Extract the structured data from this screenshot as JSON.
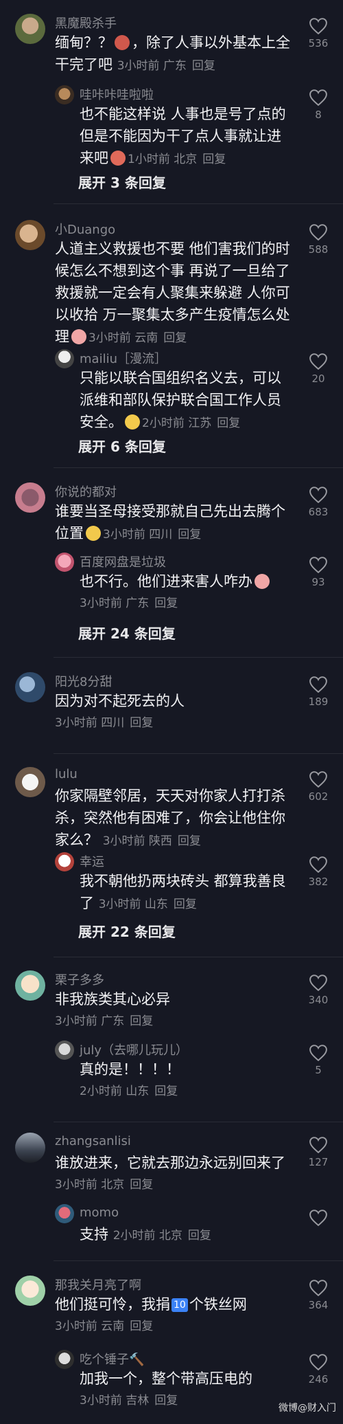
{
  "comments": [
    {
      "user": "黑魔殿杀手",
      "l1": "缅甸？？",
      "l1b": "，除了人事以外基本上全",
      "l2": "干完了吧",
      "time": "3小时前",
      "loc": "广东",
      "reply": "回复",
      "likes": "536",
      "sub": {
        "user": "哇咔咔哇啦啦",
        "l1": "也不能这样说 人事也是号了点的",
        "l2": "但是不能因为干了点人事就让进",
        "l3": "来吧",
        "time": "1小时前",
        "loc": "北京",
        "reply": "回复",
        "likes": "8"
      },
      "expand": "展开 3 条回复"
    },
    {
      "user": "小Duango",
      "l1": "人道主义救援也不要 他们害我们的时",
      "l2": "候怎么不想到这个事 再说了一旦给了",
      "l3": "救援就一定会有人聚集来躲避 人你可",
      "l4": "以收拾 万一聚集太多产生疫情怎么处",
      "l5": "理",
      "time": "3小时前",
      "loc": "云南",
      "reply": "回复",
      "likes": "588",
      "sub": {
        "user": "mailiu［漫流］",
        "l1": "只能以联合国组织名义去，可以",
        "l2": "派维和部队保护联合国工作人员",
        "l3": "安全。",
        "time": "2小时前",
        "loc": "江苏",
        "reply": "回复",
        "likes": "20"
      },
      "expand": "展开 6 条回复"
    },
    {
      "user": "你说的都对",
      "l1": "谁要当圣母接受那就自己先出去腾个",
      "l2": "位置",
      "time": "3小时前",
      "loc": "四川",
      "reply": "回复",
      "likes": "683",
      "sub": {
        "user": "百度网盘是垃圾",
        "l1": "也不行。他们进来害人咋办",
        "time": "3小时前",
        "loc": "广东",
        "reply": "回复",
        "likes": "93"
      },
      "expand": "展开 24 条回复"
    },
    {
      "user": "阳光8分甜",
      "l1": "因为对不起死去的人",
      "time": "3小时前",
      "loc": "四川",
      "reply": "回复",
      "likes": "189"
    },
    {
      "user": "lulu",
      "l1": "你家隔壁邻居，天天对你家人打打杀",
      "l2": "杀，突然他有困难了，你会让他住你",
      "l3": "家么？",
      "time": "3小时前",
      "loc": "陕西",
      "reply": "回复",
      "likes": "602",
      "sub": {
        "user": "幸运",
        "l1": "我不朝他扔两块砖头 都算我善良",
        "l2": "了",
        "time": "3小时前",
        "loc": "山东",
        "reply": "回复",
        "likes": "382"
      },
      "expand": "展开 22 条回复"
    },
    {
      "user": "栗子多多",
      "l1": "非我族类其心必异",
      "time": "3小时前",
      "loc": "广东",
      "reply": "回复",
      "likes": "340",
      "sub": {
        "user": "july（去哪儿玩儿）",
        "l1": "真的是！！！！",
        "time": "2小时前",
        "loc": "山东",
        "reply": "回复",
        "likes": "5"
      }
    },
    {
      "user": "zhangsanlisi",
      "l1": "谁放进来，它就去那边永远别回来了",
      "time": "3小时前",
      "loc": "北京",
      "reply": "回复",
      "likes": "127",
      "sub": {
        "user": "momo",
        "l1": "支持",
        "time": "2小时前",
        "loc": "北京",
        "reply": "回复",
        "likes": ""
      }
    },
    {
      "user": "那我关月亮了啊",
      "l1": "他们挺可怜，我捐",
      "l1b": "个铁丝网",
      "badge": "10",
      "time": "3小时前",
      "loc": "云南",
      "reply": "回复",
      "likes": "364",
      "sub": {
        "user": "吃个锤子🔨",
        "l1": "加我一个，整个带高压电的",
        "time": "3小时前",
        "loc": "吉林",
        "reply": "回复",
        "likes": "246"
      }
    }
  ],
  "watermark": "微博@财入门",
  "colors": {
    "bg": "#161823",
    "muted": "#8a8b91",
    "text": "#f2f2f4"
  }
}
